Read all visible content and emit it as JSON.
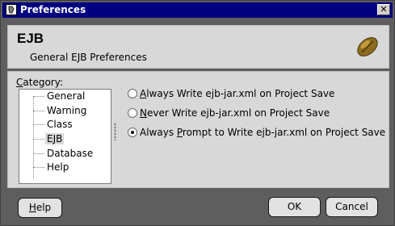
{
  "window": {
    "title": "Preferences",
    "close_label": "✕"
  },
  "header": {
    "title": "EJB",
    "subtitle": "General EJB Preferences"
  },
  "category": {
    "label": "Category:",
    "items": [
      {
        "label": "General"
      },
      {
        "label": "Warning"
      },
      {
        "label": "Class"
      },
      {
        "label": "EJB",
        "selected": true
      },
      {
        "label": "Database"
      },
      {
        "label": "Help"
      }
    ]
  },
  "options": [
    {
      "pre": "",
      "mnemonic": "A",
      "post": "lways Write ejb-jar.xml on Project Save",
      "checked": false
    },
    {
      "pre": "",
      "mnemonic": "N",
      "post": "ever Write ejb-jar.xml on Project Save",
      "checked": false
    },
    {
      "pre": "Always ",
      "mnemonic": "P",
      "post": "rompt to Write ejb-jar.xml on Project Save",
      "checked": true
    }
  ],
  "buttons": {
    "help": {
      "mnemonic": "H",
      "rest": "elp"
    },
    "ok": "OK",
    "cancel": "Cancel"
  },
  "colors": {
    "titlebar": "#000080",
    "frame": "#5e5e5e",
    "panel": "#d8d8d8",
    "bean": "#8b6b1e"
  },
  "icons": {
    "app": "app-icon",
    "bean": "java-bean-icon",
    "close": "close-icon"
  }
}
